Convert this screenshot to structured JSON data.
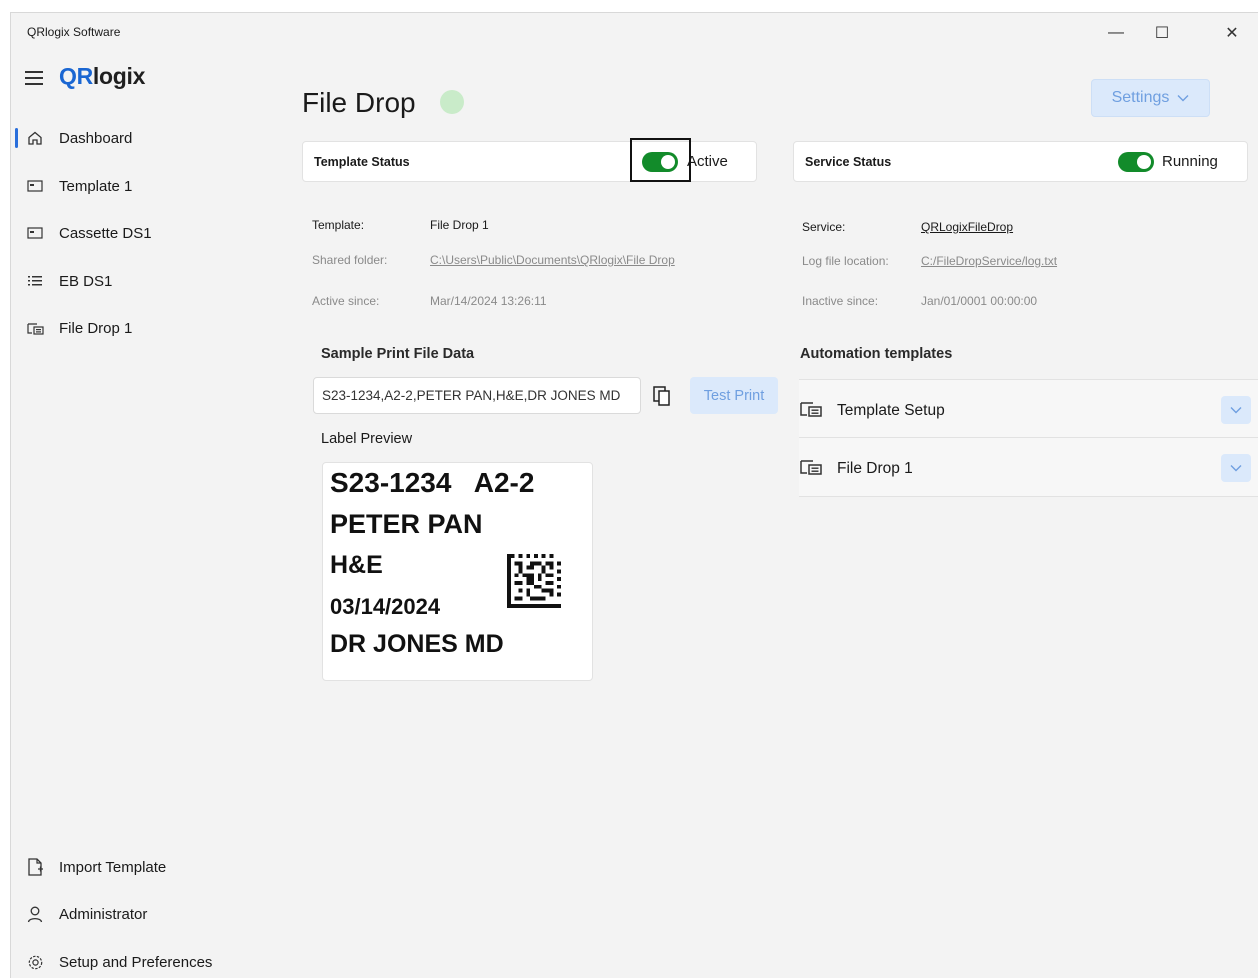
{
  "window": {
    "title": "QRlogix Software",
    "controls": {
      "minimize": "—",
      "maximize": "☐",
      "close": "✕"
    }
  },
  "sidebar": {
    "logo_prefix": "QR",
    "logo_suffix": "logix",
    "items": [
      {
        "label": "Dashboard",
        "icon": "home-icon"
      },
      {
        "label": "Template 1",
        "icon": "card-icon"
      },
      {
        "label": "Cassette DS1",
        "icon": "card-icon"
      },
      {
        "label": "EB DS1",
        "icon": "list-icon"
      },
      {
        "label": "File Drop 1",
        "icon": "file-drop-icon"
      }
    ],
    "bottom_items": [
      {
        "label": "Import Template",
        "icon": "import-file-icon"
      },
      {
        "label": "Administrator",
        "icon": "person-icon"
      },
      {
        "label": "Setup and Preferences",
        "icon": "gear-icon"
      }
    ]
  },
  "main": {
    "title": "File Drop",
    "settings_label": "Settings",
    "template_status": {
      "label": "Template Status",
      "toggle_text": "Active",
      "toggle_on": true,
      "fields": [
        {
          "label": "Template:",
          "value": "File Drop 1"
        },
        {
          "label": "Shared folder:",
          "value": "C:\\Users\\Public\\Documents\\QRlogix\\File Drop"
        },
        {
          "label": "Active since:",
          "value": "Mar/14/2024 13:26:11"
        }
      ]
    },
    "service_status": {
      "label": "Service Status",
      "toggle_text": "Running",
      "toggle_on": true,
      "fields": [
        {
          "label": "Service:",
          "value": "QRLogixFileDrop"
        },
        {
          "label": "Log file location:",
          "value": "C:/FileDropService/log.txt"
        },
        {
          "label": "Inactive since:",
          "value": "Jan/01/0001 00:00:00"
        }
      ]
    },
    "sample": {
      "heading": "Sample Print File Data",
      "value": "S23-1234,A2-2,PETER PAN,H&E,DR JONES MD",
      "test_print_label": "Test Print"
    },
    "label_preview": {
      "heading": "Label Preview",
      "lines": [
        "S23-1234   A2-2",
        "PETER PAN",
        "H&E",
        "03/14/2024",
        "DR JONES MD"
      ]
    },
    "automation": {
      "heading": "Automation templates",
      "items": [
        {
          "label": "Template Setup"
        },
        {
          "label": "File Drop 1"
        }
      ]
    }
  },
  "colors": {
    "accent": "#1a66d2",
    "toggle_on": "#128b2a",
    "button_bg": "#dbe9fb",
    "status_dot": "#c9ebc9"
  }
}
